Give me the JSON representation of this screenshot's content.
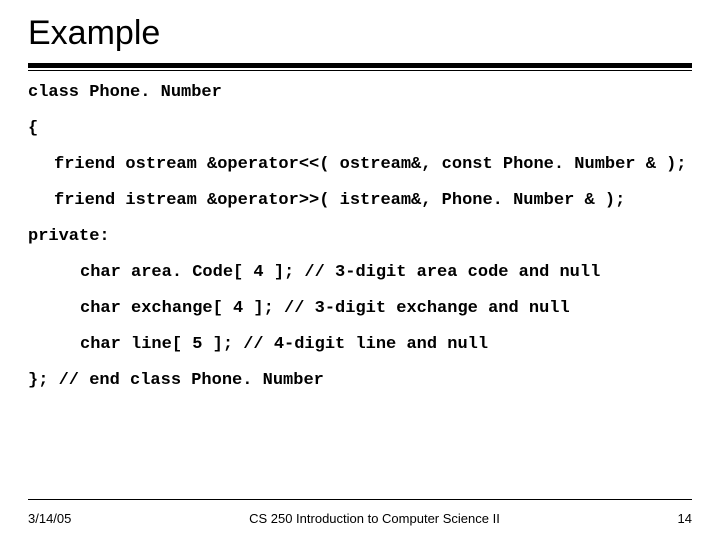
{
  "title": "Example",
  "code": {
    "class_decl": "class Phone. Number",
    "open_brace": "{",
    "friend_ostream": "friend ostream &operator<<( ostream&, const Phone. Number & );",
    "friend_istream": "friend istream &operator>>( istream&, Phone. Number & );",
    "private_label": "private:",
    "area_code": "char area. Code[ 4 ];  // 3-digit area code and null",
    "exchange": "char exchange[ 4 ];   // 3-digit exchange and null",
    "line": "char line[ 5 ];       // 4-digit line and null",
    "end_class": "}; // end class Phone. Number"
  },
  "footer": {
    "date": "3/14/05",
    "course": "CS 250 Introduction to Computer Science II",
    "page": "14"
  }
}
